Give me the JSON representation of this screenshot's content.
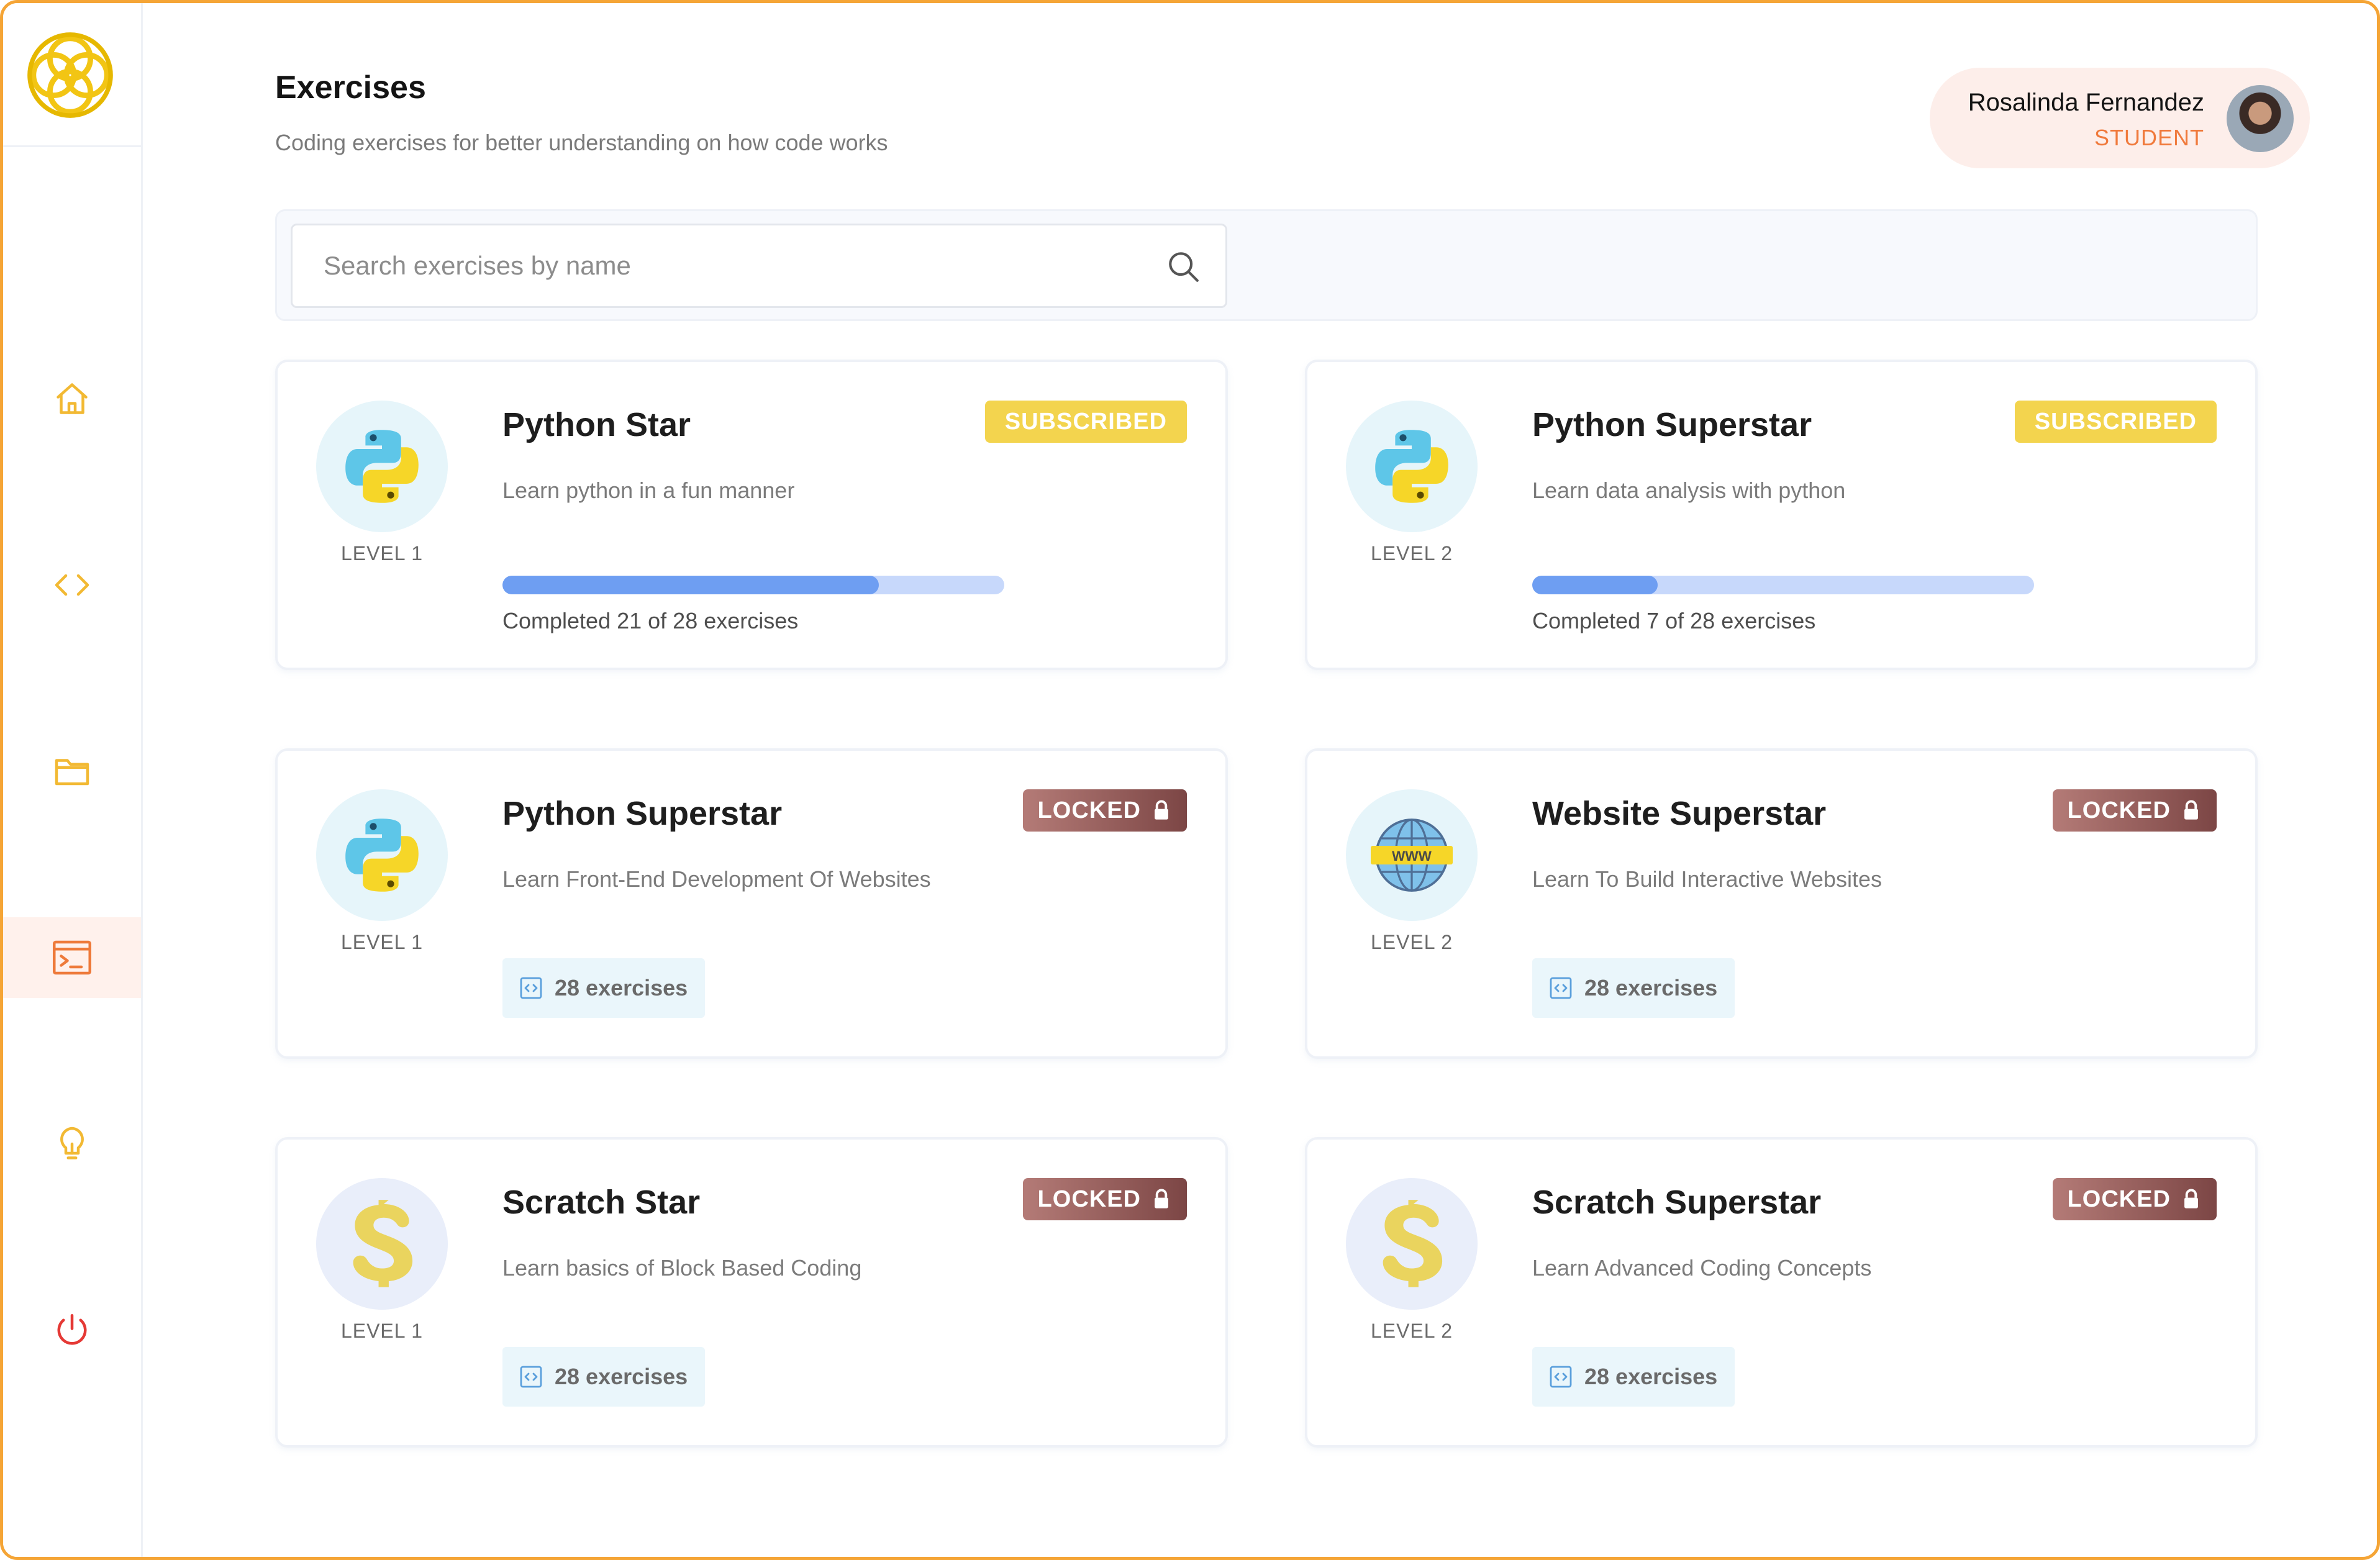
{
  "header": {
    "title": "Exercises",
    "subtitle": "Coding exercises for better understanding on how code works"
  },
  "user": {
    "name": "Rosalinda Fernandez",
    "role": "STUDENT"
  },
  "search": {
    "placeholder": "Search exercises by name",
    "value": ""
  },
  "sidebar": {
    "items": [
      {
        "icon": "home-icon",
        "active": false
      },
      {
        "icon": "code-icon",
        "active": false
      },
      {
        "icon": "folder-icon",
        "active": false
      },
      {
        "icon": "terminal-icon",
        "active": true
      },
      {
        "icon": "lightbulb-icon",
        "active": false
      },
      {
        "icon": "power-icon",
        "active": false
      }
    ]
  },
  "colors": {
    "accent": "#f5a536",
    "subscribed": "#f3d44e",
    "locked": "#8c5552",
    "progress": "#6e9ef2",
    "logout": "#e53935"
  },
  "cards": [
    {
      "title": "Python Star",
      "description": "Learn python in a fun manner",
      "level": "LEVEL 1",
      "icon": "python-icon",
      "badge": "SUBSCRIBED",
      "progress_text": "Completed 21 of 28 exercises",
      "progress": 0.75
    },
    {
      "title": "Python Superstar",
      "description": "Learn data analysis with python",
      "level": "LEVEL 2",
      "icon": "python-icon",
      "badge": "SUBSCRIBED",
      "progress_text": "Completed 7 of 28 exercises",
      "progress": 0.25
    },
    {
      "title": "Python Superstar",
      "description": "Learn Front-End Development Of Websites",
      "level": "LEVEL 1",
      "icon": "python-icon",
      "badge": "LOCKED",
      "exercises": "28 exercises"
    },
    {
      "title": "Website Superstar",
      "description": "Learn To Build Interactive Websites",
      "level": "LEVEL 2",
      "icon": "globe-www-icon",
      "badge": "LOCKED",
      "exercises": "28 exercises"
    },
    {
      "title": "Scratch Star",
      "description": "Learn basics of Block Based Coding",
      "level": "LEVEL 1",
      "icon": "scratch-icon",
      "badge": "LOCKED",
      "exercises": "28 exercises"
    },
    {
      "title": "Scratch Superstar",
      "description": "Learn Advanced Coding Concepts",
      "level": "LEVEL 2",
      "icon": "scratch-icon",
      "badge": "LOCKED",
      "exercises": "28 exercises"
    }
  ]
}
